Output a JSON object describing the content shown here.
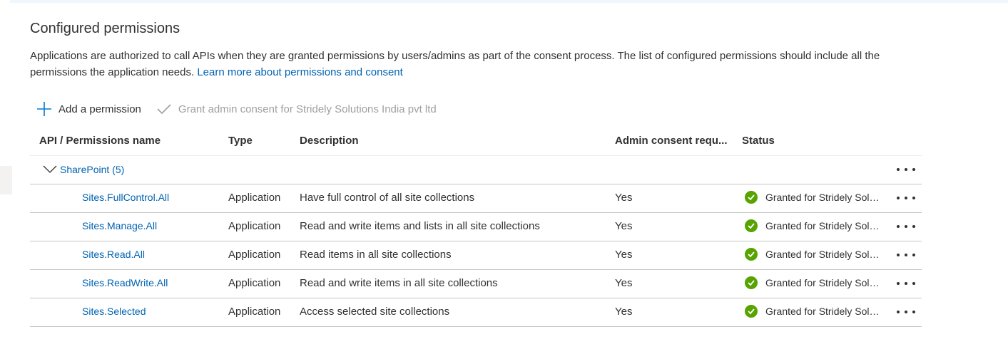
{
  "section": {
    "title": "Configured permissions",
    "description": "Applications are authorized to call APIs when they are granted permissions by users/admins as part of the consent process. The list of configured permissions should include all the permissions the application needs.",
    "learn_more": "Learn more about permissions and consent"
  },
  "toolbar": {
    "add_label": "Add a permission",
    "grant_label": "Grant admin consent for Stridely Solutions India pvt ltd"
  },
  "table": {
    "columns": [
      "API / Permissions name",
      "Type",
      "Description",
      "Admin consent requ...",
      "Status"
    ],
    "group": {
      "label": "SharePoint (5)"
    },
    "rows": [
      {
        "name": "Sites.FullControl.All",
        "type": "Application",
        "description": "Have full control of all site collections",
        "admin": "Yes",
        "status": "Granted for Stridely Solutions India pvt ltd"
      },
      {
        "name": "Sites.Manage.All",
        "type": "Application",
        "description": "Read and write items and lists in all site collections",
        "admin": "Yes",
        "status": "Granted for Stridely Solutions India pvt ltd"
      },
      {
        "name": "Sites.Read.All",
        "type": "Application",
        "description": "Read items in all site collections",
        "admin": "Yes",
        "status": "Granted for Stridely Solutions India pvt ltd"
      },
      {
        "name": "Sites.ReadWrite.All",
        "type": "Application",
        "description": "Read and write items in all site collections",
        "admin": "Yes",
        "status": "Granted for Stridely Solutions India pvt ltd"
      },
      {
        "name": "Sites.Selected",
        "type": "Application",
        "description": "Access selected site collections",
        "admin": "Yes",
        "status": "Granted for Stridely Solutions India pvt ltd"
      }
    ]
  },
  "colors": {
    "link": "#0063b1",
    "granted": "#57a300",
    "disabled": "#a19f9d"
  },
  "icons": {
    "add": "plus-icon",
    "grant": "checkmark-icon",
    "status": "check-circle-icon",
    "more": "more-icon",
    "expand": "chevron-down-icon"
  }
}
